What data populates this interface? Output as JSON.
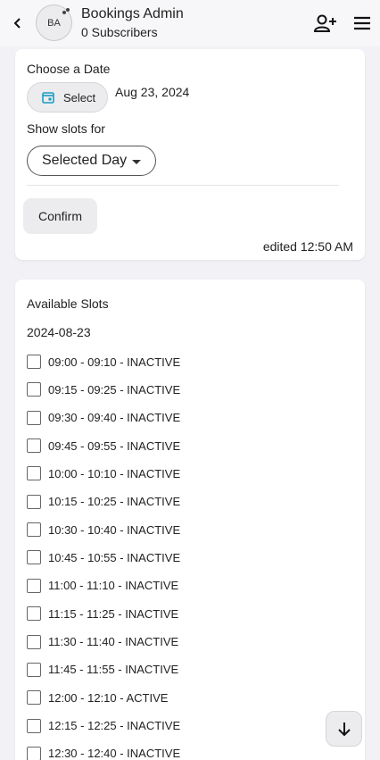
{
  "header": {
    "avatar_initials": "BA",
    "title": "Bookings Admin",
    "subscribers": "0 Subscribers"
  },
  "date_card": {
    "choose_date_label": "Choose a Date",
    "select_label": "Select",
    "selected_date": "Aug 23, 2024",
    "show_slots_label": "Show slots for",
    "slots_filter_value": "Selected Day",
    "confirm_label": "Confirm",
    "edited_text": "edited 12:50 AM"
  },
  "slots_card": {
    "heading": "Available Slots",
    "date": "2024-08-23",
    "slots": [
      {
        "label": "09:00 - 09:10 - INACTIVE",
        "checked": false
      },
      {
        "label": "09:15 - 09:25 - INACTIVE",
        "checked": false
      },
      {
        "label": "09:30 - 09:40 - INACTIVE",
        "checked": false
      },
      {
        "label": "09:45 - 09:55 - INACTIVE",
        "checked": false
      },
      {
        "label": "10:00 - 10:10 - INACTIVE",
        "checked": false
      },
      {
        "label": "10:15 - 10:25 - INACTIVE",
        "checked": false
      },
      {
        "label": "10:30 - 10:40 - INACTIVE",
        "checked": false
      },
      {
        "label": "10:45 - 10:55 - INACTIVE",
        "checked": false
      },
      {
        "label": "11:00 - 11:10 - INACTIVE",
        "checked": false
      },
      {
        "label": "11:15 - 11:25 - INACTIVE",
        "checked": false
      },
      {
        "label": "11:30 - 11:40 - INACTIVE",
        "checked": false
      },
      {
        "label": "11:45 - 11:55 - INACTIVE",
        "checked": false
      },
      {
        "label": "12:00 - 12:10 - ACTIVE",
        "checked": false
      },
      {
        "label": "12:15 - 12:25 - INACTIVE",
        "checked": false
      },
      {
        "label": "12:30 - 12:40 - INACTIVE",
        "checked": false
      }
    ]
  },
  "icons": {
    "back": "chevron-left-icon",
    "add_user": "person-add-icon",
    "menu": "hamburger-menu-icon",
    "calendar": "calendar-icon",
    "scroll_down": "arrow-down-icon"
  },
  "colors": {
    "accent": "#1a9cc4",
    "background": "#f2f2f6"
  }
}
